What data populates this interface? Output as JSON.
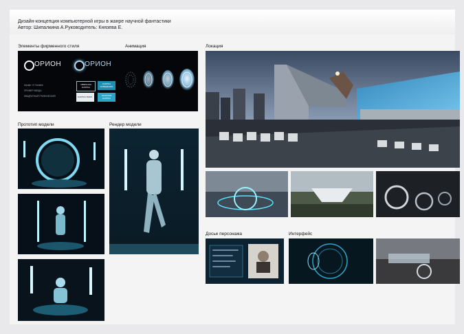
{
  "header": {
    "title": "Дизайн-концепция компьютерной игры в жанре научной фантастики",
    "authors": "Автор: Шипалкина А.Руководитель: Князева Е."
  },
  "sections": {
    "brand": "Элементы фирменного стиля",
    "animation": "Анимация",
    "location": "Локация",
    "prototype": "Прототип модели",
    "render": "Рендер модели",
    "dossier": "Досье персонажа",
    "interface": "Интерфейс"
  },
  "brand_panel": {
    "logo_text": "ОРИОН",
    "notes": [
      "Шрифт: IV Variable",
      "ПРИМЕР ВВОДА",
      "КВАДРАТНЫЙ ГРАФИЧЕСКИЙ"
    ],
    "buttons": [
      "ОБЫЧНАЯ КНОПКА",
      "КНОПКА НАВЕДЕНИЯ",
      "КНОПКА ВЫКЛ.",
      "НАЖАТАЯ КНОПКА"
    ]
  },
  "colors": {
    "accent": "#2aa6c8",
    "glow": "#7fd9f2",
    "panel_bg": "#05070c"
  }
}
